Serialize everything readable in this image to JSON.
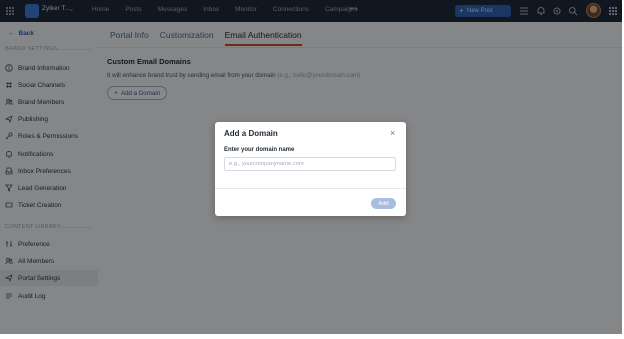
{
  "topbar": {
    "brand_name": "Zylker T...",
    "brand_caret": "⌄",
    "nav": [
      "Home",
      "Posts",
      "Messages",
      "Inbox",
      "Monitor",
      "Connections",
      "Campaigns"
    ],
    "more": "•••",
    "new_post_label": "New Post",
    "new_post_plus": "+"
  },
  "sidebar": {
    "back_arrow": "←",
    "back_label": "Back",
    "brand_settings_label": "BRAND SETTINGS",
    "brand_items": [
      {
        "label": "Brand Information",
        "icon": "info-icon"
      },
      {
        "label": "Social Channels",
        "icon": "channels-icon"
      },
      {
        "label": "Brand Members",
        "icon": "members-icon"
      },
      {
        "label": "Publishing",
        "icon": "send-icon"
      },
      {
        "label": "Roles & Permissions",
        "icon": "key-icon"
      },
      {
        "label": "Notifications",
        "icon": "bell-icon"
      },
      {
        "label": "Inbox Preferences",
        "icon": "inbox-icon"
      },
      {
        "label": "Lead Generation",
        "icon": "funnel-icon"
      },
      {
        "label": "Ticket Creation",
        "icon": "ticket-icon"
      }
    ],
    "content_library_label": "CONTENT LIBRARY",
    "library_items": [
      {
        "label": "Preference",
        "icon": "sliders-icon"
      },
      {
        "label": "All Members",
        "icon": "members-icon"
      },
      {
        "label": "Portal Settings",
        "icon": "send-icon",
        "active": true
      },
      {
        "label": "Audit Log",
        "icon": "list-icon"
      }
    ]
  },
  "main": {
    "tabs": [
      {
        "label": "Portal Info",
        "active": false
      },
      {
        "label": "Customization",
        "active": false
      },
      {
        "label": "Email Authentication",
        "active": true
      }
    ],
    "section_title": "Custom Email Domains",
    "section_desc": "It will enhance brand trust by sending email from your domain",
    "section_example": "(e.g., hello@yourdomain.com)",
    "add_domain_plus": "+",
    "add_domain_label": "Add a Domain"
  },
  "modal": {
    "title": "Add a Domain",
    "close_glyph": "×",
    "field_label": "Enter your domain name",
    "field_placeholder": "e.g., yourcompanyname.com",
    "field_value": "",
    "add_label": "Add"
  },
  "colors": {
    "topbar": "#1e2b3d",
    "accent": "#2f63b8",
    "tab_underline": "#c8502a",
    "disabled_button": "#a9bedf"
  }
}
